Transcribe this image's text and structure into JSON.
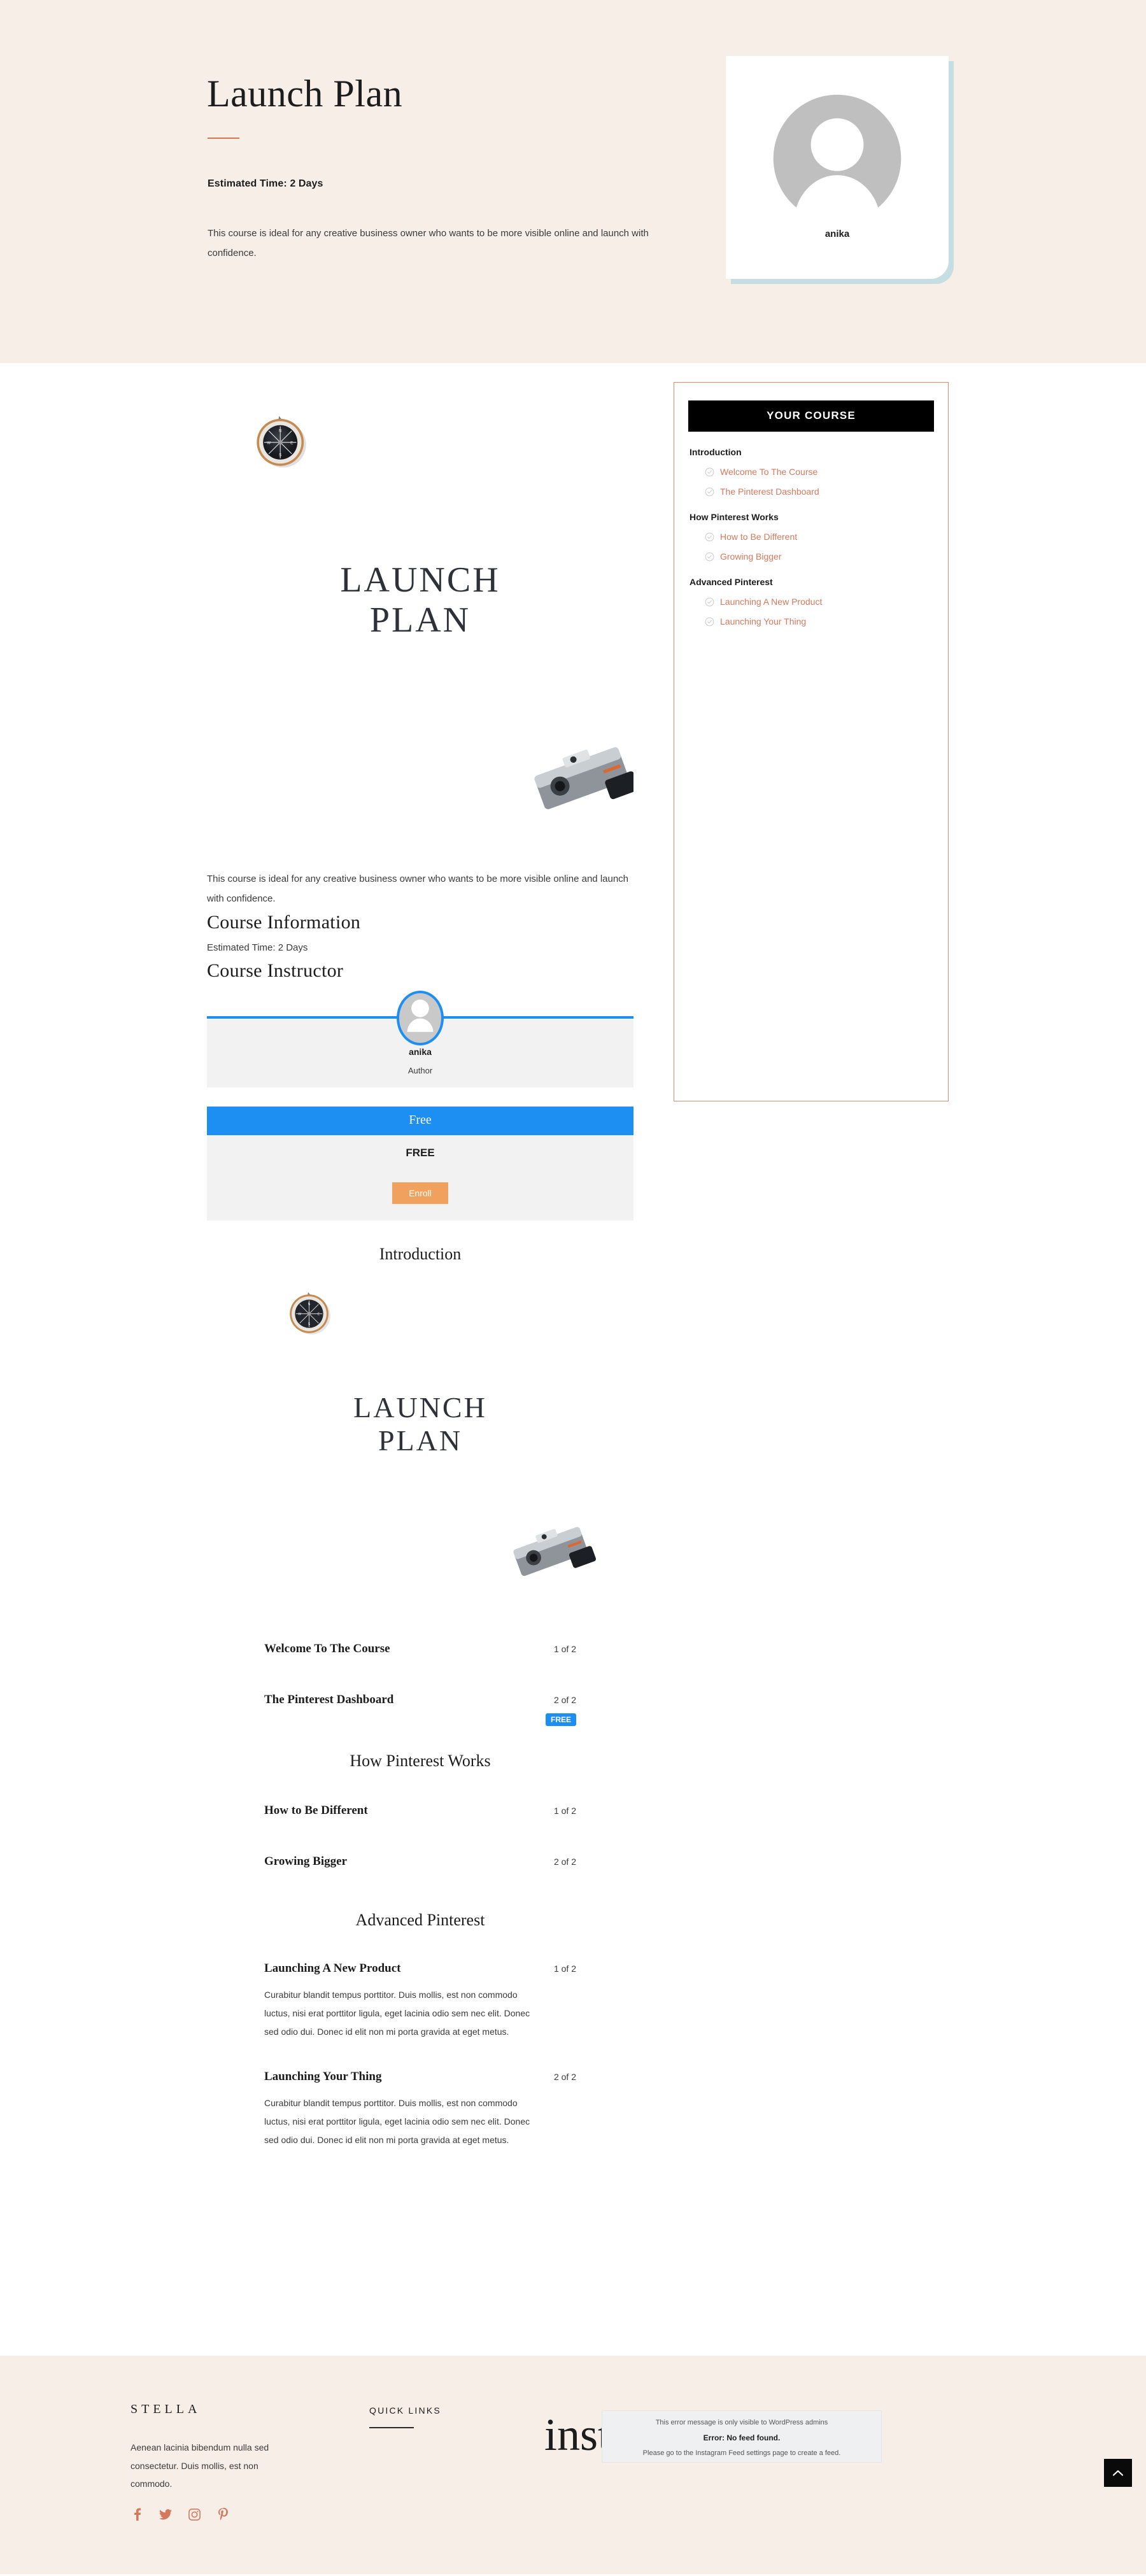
{
  "hero": {
    "title": "Launch Plan",
    "estimated_time": "Estimated Time: 2 Days",
    "description": "This course is ideal for any creative business owner who wants to be more visible online and launch with confidence.",
    "author_name": "anika"
  },
  "featured": {
    "line1": "LAUNCH",
    "line2": "PLAN"
  },
  "course": {
    "description": "This course is ideal for any creative business owner who wants to be more visible online and launch with confidence.",
    "information_heading": "Course Information",
    "estimated_time": "Estimated Time: 2 Days",
    "instructor_heading": "Course Instructor",
    "instructor_name": "anika",
    "instructor_role": "Author",
    "price_header": "Free",
    "price_value": "FREE",
    "enroll_label": "Enroll"
  },
  "sidebar": {
    "header": "YOUR COURSE",
    "groups": [
      {
        "title": "Introduction",
        "items": [
          {
            "label": "Welcome To The Course",
            "icon": "check-circle-icon"
          },
          {
            "label": "The Pinterest Dashboard",
            "icon": "check-circle-icon"
          }
        ]
      },
      {
        "title": "How Pinterest Works",
        "items": [
          {
            "label": "How to Be Different",
            "icon": "check-circle-icon"
          },
          {
            "label": "Growing Bigger",
            "icon": "check-circle-icon"
          }
        ]
      },
      {
        "title": "Advanced Pinterest",
        "items": [
          {
            "label": "Launching A New Product",
            "icon": "check-circle-icon"
          },
          {
            "label": "Launching Your Thing",
            "icon": "check-circle-icon"
          }
        ]
      }
    ]
  },
  "curriculum": [
    {
      "section": "Introduction",
      "lessons": [
        {
          "title": "Welcome To The Course",
          "progress": "1 of 2",
          "badge": "",
          "desc": ""
        },
        {
          "title": "The Pinterest Dashboard",
          "progress": "2 of 2",
          "badge": "FREE",
          "desc": ""
        }
      ]
    },
    {
      "section": "How Pinterest Works",
      "lessons": [
        {
          "title": "How to Be Different",
          "progress": "1 of 2",
          "badge": "",
          "desc": ""
        },
        {
          "title": "Growing Bigger",
          "progress": "2 of 2",
          "badge": "",
          "desc": ""
        }
      ]
    },
    {
      "section": "Advanced Pinterest",
      "lessons": [
        {
          "title": "Launching A New Product",
          "progress": "1 of 2",
          "badge": "",
          "desc": "Curabitur blandit tempus porttitor. Duis mollis, est non commodo luctus, nisi erat porttitor ligula, eget lacinia odio sem nec elit. Donec sed odio dui. Donec id elit non mi porta gravida at eget metus."
        },
        {
          "title": "Launching Your Thing",
          "progress": "2 of 2",
          "badge": "",
          "desc": "Curabitur blandit tempus porttitor. Duis mollis, est non commodo luctus, nisi erat porttitor ligula, eget lacinia odio sem nec elit. Donec sed odio dui. Donec id elit non mi porta gravida at eget metus."
        }
      ]
    }
  ],
  "footer": {
    "brand": "STELLA",
    "about": "Aenean lacinia bibendum nulla sed consectetur. Duis mollis, est non commodo.",
    "quick_links_title": "QUICK LINKS",
    "insta_word": "insta",
    "social": [
      {
        "name": "facebook-icon"
      },
      {
        "name": "twitter-icon"
      },
      {
        "name": "instagram-icon"
      },
      {
        "name": "pinterest-icon"
      }
    ],
    "insta_error": {
      "line1": "This error message is only visible to WordPress admins",
      "line2": "Error: No feed found.",
      "line3": "Please go to the Instagram Feed settings page to create a feed."
    }
  },
  "colors": {
    "cream": "#f8eee8",
    "coral": "#d4795c",
    "blue": "#1d8ef2",
    "orange": "#f0a15e",
    "black": "#000000"
  }
}
